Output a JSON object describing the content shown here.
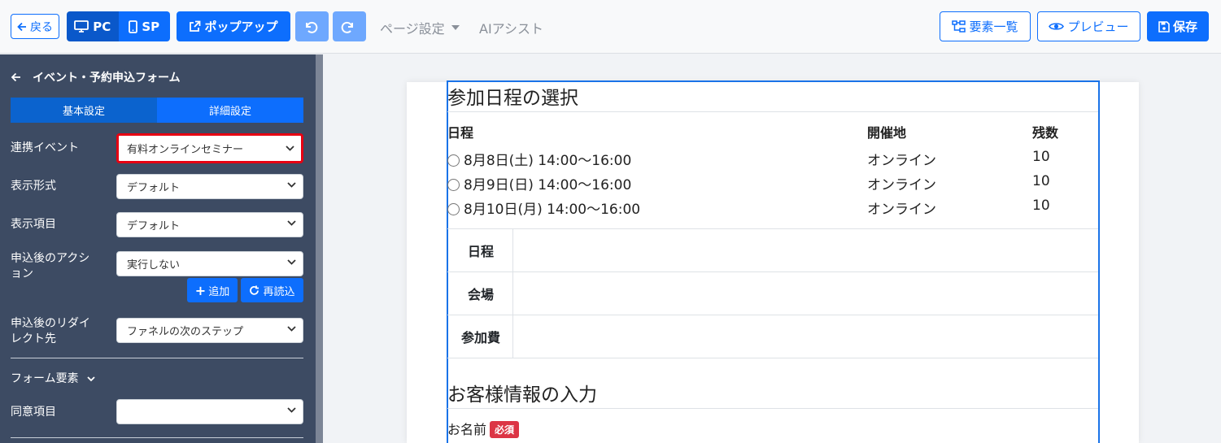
{
  "toolbar": {
    "back_label": "戻る",
    "pc_label": "PC",
    "sp_label": "SP",
    "popup_label": "ポップアップ",
    "page_settings_label": "ページ設定",
    "ai_assist_label": "AIアシスト",
    "elements_label": "要素一覧",
    "preview_label": "プレビュー",
    "save_label": "保存"
  },
  "sidebar": {
    "title": "イベント・予約申込フォーム",
    "tabs": [
      "基本設定",
      "詳細設定"
    ],
    "fields": [
      {
        "label": "連携イベント",
        "value": "有料オンラインセミナー"
      },
      {
        "label": "表示形式",
        "value": "デフォルト"
      },
      {
        "label": "表示項目",
        "value": "デフォルト"
      },
      {
        "label": "申込後のアクション",
        "value": "実行しない"
      },
      {
        "label": "申込後のリダイレクト先",
        "value": "ファネルの次のステップ"
      }
    ],
    "add_label": "追加",
    "reload_label": "再読込",
    "form_elements_label": "フォーム要素",
    "consent_label": "同意項目",
    "consent_value": ""
  },
  "form": {
    "section1_title": "参加日程の選択",
    "headers": [
      "日程",
      "開催地",
      "残数"
    ],
    "rows": [
      {
        "date": "8月8日(土) 14:00〜16:00",
        "place": "オンライン",
        "remaining": "10"
      },
      {
        "date": "8月9日(日) 14:00〜16:00",
        "place": "オンライン",
        "remaining": "10"
      },
      {
        "date": "8月10日(月) 14:00〜16:00",
        "place": "オンライン",
        "remaining": "10"
      }
    ],
    "detail_labels": [
      "日程",
      "会場",
      "参加費"
    ],
    "section2_title": "お客様情報の入力",
    "name_label": "お名前",
    "required_badge": "必須"
  },
  "colors": {
    "accent": "#0d6efd",
    "sidebar_bg": "#3d4b63",
    "highlight": "#e60012",
    "required": "#dc3545"
  }
}
